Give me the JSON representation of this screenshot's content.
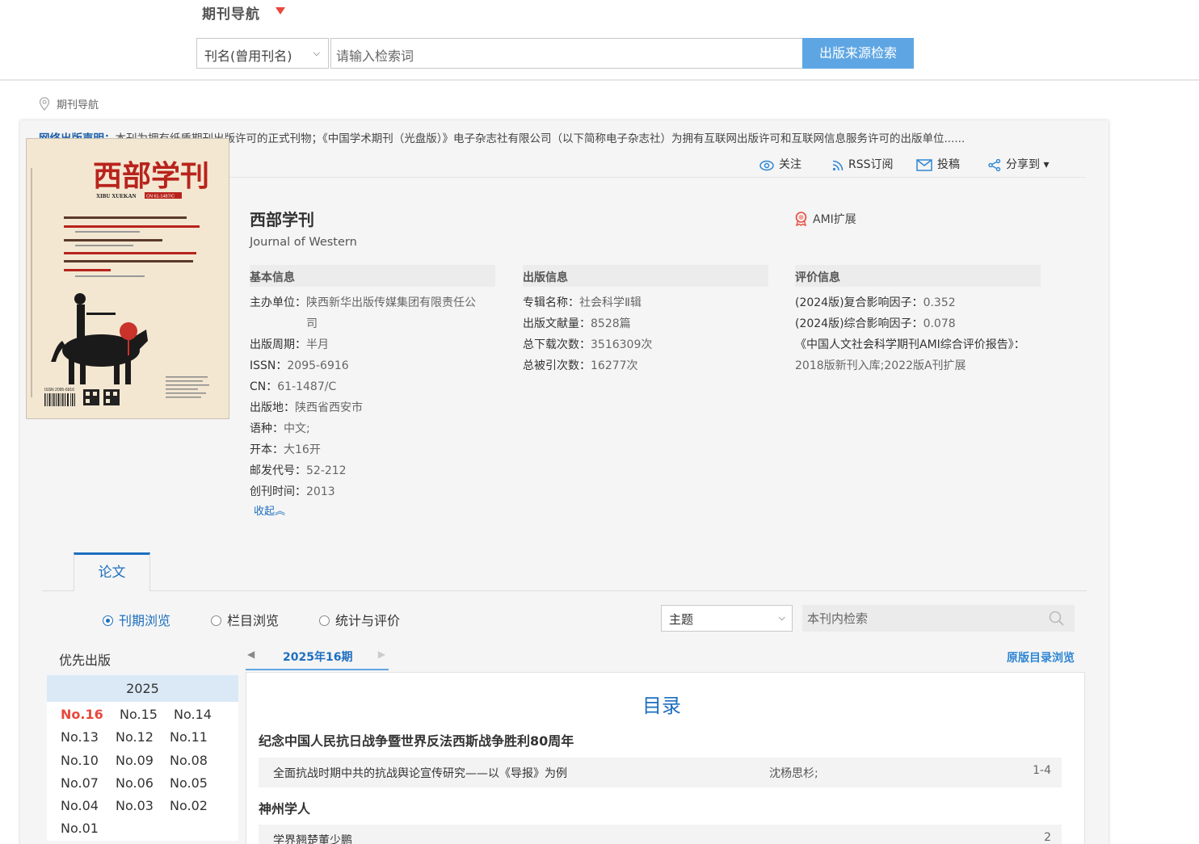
{
  "header": {
    "nav_title": "期刊导航",
    "search_type": "刊名(曾用刊名)",
    "search_placeholder": "请输入检索词",
    "search_button": "出版来源检索"
  },
  "breadcrumb": "期刊导航",
  "notice": {
    "label": "网络出版声明：",
    "text": "本刊为拥有纸质期刊出版许可的正式刊物；《中国学术期刊（光盘版）》电子杂志社有限公司（以下简称电子杂志社）为拥有互联网出版许可和互联网信息服务许可的出版单位......"
  },
  "actions": {
    "follow": "关注",
    "rss": "RSS订阅",
    "submit": "投稿",
    "share": "分享到 ▾"
  },
  "journal": {
    "title": "西部学刊",
    "english_title": "Journal of Western",
    "ami": "AMI扩展",
    "cover": {
      "logo_text": "西部学刊",
      "pinyin": "XIBU XUEKAN",
      "cn_badge": "CN 61-1487/C",
      "issn_text": "ISSN 2095-6916"
    }
  },
  "basic_info": {
    "heading": "基本信息",
    "publisher_label": "主办单位：",
    "publisher_line1": "陕西新华出版传媒集团有限责任公",
    "publisher_line2": "司",
    "cycle_label": "出版周期：",
    "cycle": "半月",
    "issn_label": "ISSN：",
    "issn": "2095-6916",
    "cn_label": "CN：",
    "cn": "61-1487/C",
    "place_label": "出版地：",
    "place": "陕西省西安市",
    "lang_label": "语种：",
    "lang": "中文;",
    "format_label": "开本：",
    "format": "大16开",
    "post_label": "邮发代号：",
    "post": "52-212",
    "founded_label": "创刊时间：",
    "founded": "2013",
    "collapse": "收起︽"
  },
  "pub_info": {
    "heading": "出版信息",
    "series_label": "专辑名称：",
    "series": "社会科学Ⅱ辑",
    "docs_label": "出版文献量：",
    "docs": "8528篇",
    "downloads_label": "总下载次数：",
    "downloads": "3516309次",
    "cites_label": "总被引次数：",
    "cites": "16277次"
  },
  "eval_info": {
    "heading": "评价信息",
    "if1_label": "(2024版)复合影响因子：",
    "if1": "0.352",
    "if2_label": "(2024版)综合影响因子：",
    "if2": "0.078",
    "ami_line1": "《中国人文社会科学期刊AMI综合评价报告》：",
    "ami_line2": "2018版新刊入库;2022版A刊扩展"
  },
  "tabs": {
    "paper": "论文"
  },
  "browse": {
    "by_issue": "刊期浏览",
    "by_column": "栏目浏览",
    "stats": "统计与评价",
    "field_select": "主题",
    "inner_search_placeholder": "本刊内检索"
  },
  "issues": {
    "priority": "优先出版",
    "year": "2025",
    "list": [
      "No.16",
      "No.15",
      "No.14",
      "No.13",
      "No.12",
      "No.11",
      "No.10",
      "No.09",
      "No.08",
      "No.07",
      "No.06",
      "No.05",
      "No.04",
      "No.03",
      "No.02",
      "No.01"
    ]
  },
  "issue_nav": {
    "prev": "◀",
    "current": "2025年16期",
    "next": "▶",
    "orig_toc": "原版目录浏览"
  },
  "toc": {
    "title": "目录",
    "sections": [
      {
        "name": "纪念中国人民抗日战争暨世界反法西斯战争胜利80周年",
        "articles": [
          {
            "title": "全面抗战时期中共的抗战舆论宣传研究——以《导报》为例",
            "author": "沈杨思杉;",
            "pages": "1-4"
          }
        ]
      },
      {
        "name": "神州学人",
        "articles": [
          {
            "title": "学界翘楚董少鹏",
            "author": "",
            "pages": "2"
          }
        ]
      }
    ]
  },
  "colors": {
    "accent": "#1e6fbf",
    "button": "#5ea6e3",
    "current_issue": "#e8483c"
  }
}
